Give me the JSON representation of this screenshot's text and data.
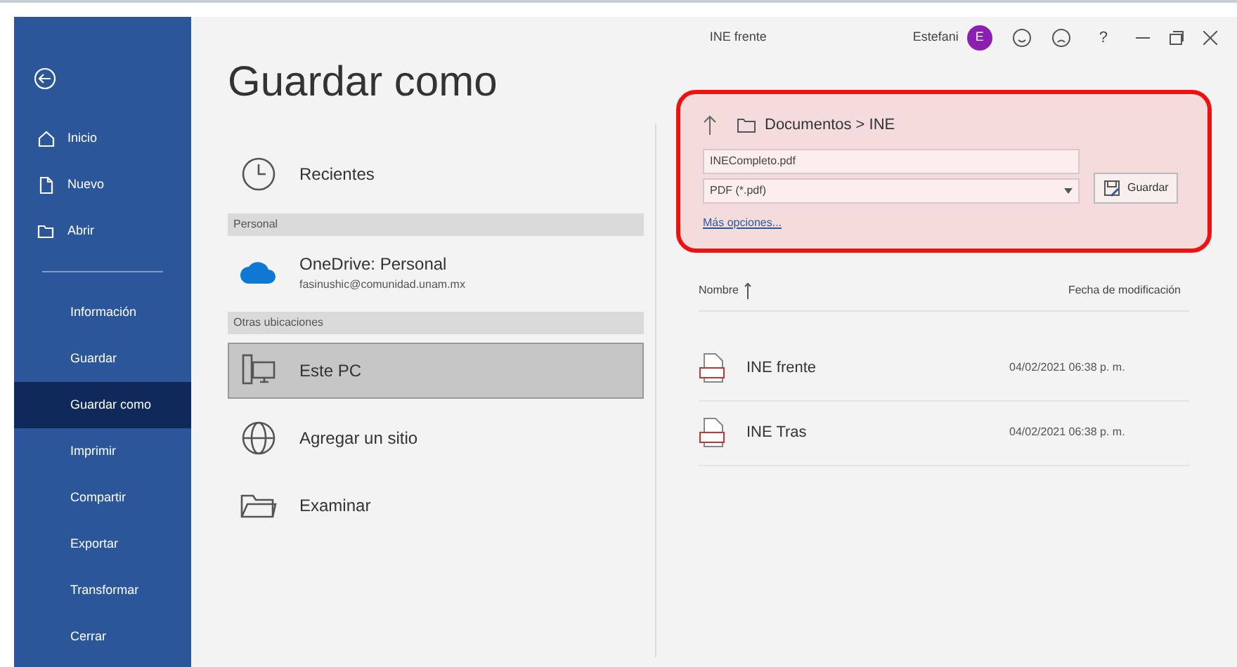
{
  "window": {
    "document_title": "INE frente",
    "user_name": "Estefani",
    "avatar_initial": "E",
    "help": "?"
  },
  "sidebar": {
    "items": [
      {
        "kind": "icon",
        "label": "Inicio",
        "selected": false
      },
      {
        "kind": "icon",
        "label": "Nuevo",
        "selected": false
      },
      {
        "kind": "icon",
        "label": "Abrir",
        "selected": false
      },
      {
        "kind": "plain",
        "label": "Información",
        "selected": false
      },
      {
        "kind": "plain",
        "label": "Guardar",
        "selected": false
      },
      {
        "kind": "plain",
        "label": "Guardar como",
        "selected": true
      },
      {
        "kind": "plain",
        "label": "Imprimir",
        "selected": false
      },
      {
        "kind": "plain",
        "label": "Compartir",
        "selected": false
      },
      {
        "kind": "plain",
        "label": "Exportar",
        "selected": false
      },
      {
        "kind": "plain",
        "label": "Transformar",
        "selected": false
      },
      {
        "kind": "plain",
        "label": "Cerrar",
        "selected": false
      }
    ]
  },
  "page_title": "Guardar como",
  "locations": [
    {
      "kind": "place",
      "label": "Recientes",
      "selected": false
    },
    {
      "kind": "header",
      "label": "Personal"
    },
    {
      "kind": "account",
      "label": "OneDrive: Personal",
      "detail": "fasinushic@comunidad.unam.mx",
      "selected": false
    },
    {
      "kind": "header",
      "label": "Otras ubicaciones"
    },
    {
      "kind": "place",
      "label": "Este PC",
      "selected": true
    },
    {
      "kind": "place",
      "label": "Agregar un sitio",
      "selected": false
    },
    {
      "kind": "place",
      "label": "Examinar",
      "selected": false
    }
  ],
  "save_panel": {
    "highlighted": true,
    "path": "Documentos > INE",
    "file_name": "INECompleto.pdf",
    "file_type": "PDF (*.pdf)",
    "save_button": "Guardar",
    "more_options": "Más opciones..."
  },
  "files": {
    "columns": [
      "Nombre",
      "Fecha de modificación"
    ],
    "rows": [
      {
        "name": "INE frente",
        "modified": "04/02/2021 06:38 p. m."
      },
      {
        "name": "INE Tras",
        "modified": "04/02/2021 06:38 p. m."
      }
    ]
  }
}
